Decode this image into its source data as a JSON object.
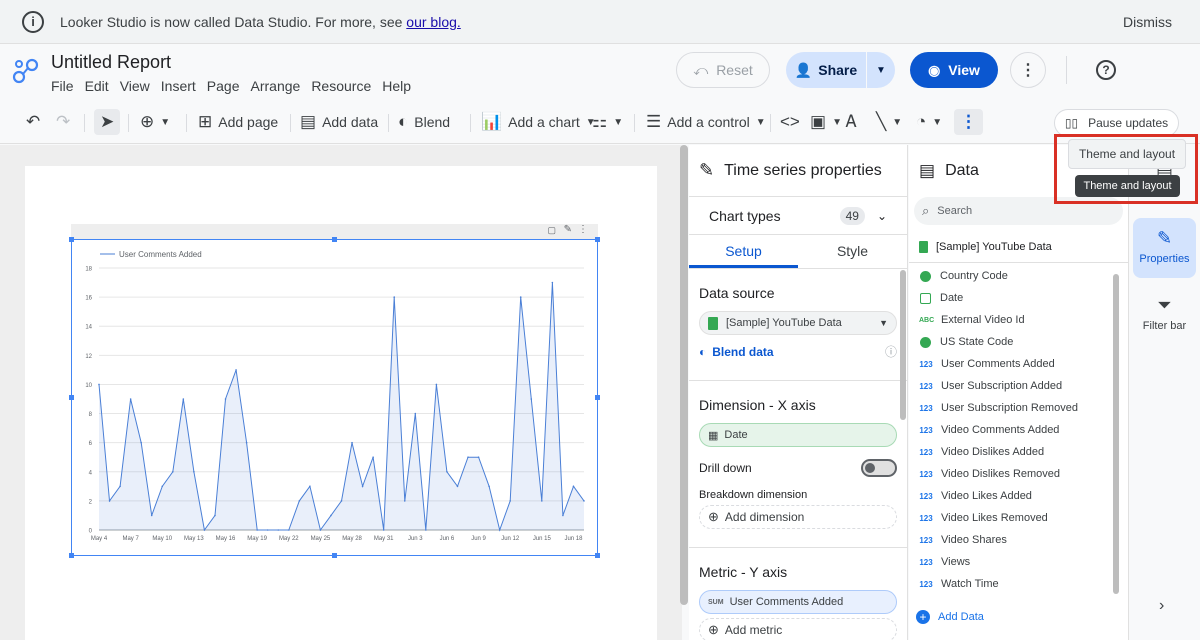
{
  "banner": {
    "message": "Looker Studio is now called Data Studio. For more, see ",
    "link": "our blog.",
    "dismiss": "Dismiss"
  },
  "header": {
    "title": "Untitled Report",
    "menu": [
      "File",
      "Edit",
      "View",
      "Insert",
      "Page",
      "Arrange",
      "Resource",
      "Help"
    ],
    "reset": "Reset",
    "share": "Share",
    "view": "View"
  },
  "toolbar": {
    "add_page": "Add page",
    "add_data": "Add data",
    "blend": "Blend",
    "add_chart": "Add a chart",
    "add_control": "Add a control",
    "pause": "Pause updates"
  },
  "chart_data": {
    "type": "line",
    "legend": "User Comments Added",
    "ylim": [
      0,
      18
    ],
    "yticks": [
      "0",
      "2",
      "4",
      "6",
      "8",
      "10",
      "12",
      "14",
      "16",
      "18"
    ],
    "xticks": [
      "May 4",
      "May 7",
      "May 10",
      "May 13",
      "May 16",
      "May 19",
      "May 22",
      "May 25",
      "May 28",
      "May 31",
      "Jun 3",
      "Jun 6",
      "Jun 9",
      "Jun 12",
      "Jun 15",
      "Jun 18"
    ],
    "values": [
      10,
      2,
      3,
      9,
      6,
      1,
      3,
      4,
      9,
      4,
      0,
      1,
      9,
      11,
      6,
      0,
      0,
      0,
      0,
      2,
      3,
      0,
      1,
      2,
      6,
      3,
      5,
      0,
      16,
      2,
      8,
      0,
      10,
      4,
      3,
      5,
      5,
      3,
      0,
      2,
      16,
      9,
      2,
      17,
      1,
      3,
      2
    ]
  },
  "properties": {
    "title": "Time series properties",
    "chart_types": "Chart types",
    "chart_types_count": "49",
    "tab_setup": "Setup",
    "tab_style": "Style",
    "data_source_title": "Data source",
    "data_source": "[Sample] YouTube Data",
    "blend_data": "Blend data",
    "dimension_title": "Dimension - X axis",
    "dimension": "Date",
    "drill_down": "Drill down",
    "breakdown": "Breakdown dimension",
    "add_dimension": "Add dimension",
    "metric_title": "Metric - Y axis",
    "metric_agg": "SUM",
    "metric": "User Comments Added",
    "add_metric": "Add metric"
  },
  "data_panel": {
    "title": "Data",
    "search": "Search",
    "source": "[Sample] YouTube Data",
    "fields": [
      {
        "icon": "geo",
        "name": "Country Code"
      },
      {
        "icon": "date",
        "name": "Date"
      },
      {
        "icon": "text",
        "name": "External Video Id"
      },
      {
        "icon": "geo",
        "name": "US State Code"
      },
      {
        "icon": "num",
        "name": "User Comments Added"
      },
      {
        "icon": "num",
        "name": "User Subscription Added"
      },
      {
        "icon": "num",
        "name": "User Subscription Removed"
      },
      {
        "icon": "num",
        "name": "Video Comments Added"
      },
      {
        "icon": "num",
        "name": "Video Dislikes Added"
      },
      {
        "icon": "num",
        "name": "Video Dislikes Removed"
      },
      {
        "icon": "num",
        "name": "Video Likes Added"
      },
      {
        "icon": "num",
        "name": "Video Likes Removed"
      },
      {
        "icon": "num",
        "name": "Video Shares"
      },
      {
        "icon": "num",
        "name": "Views"
      },
      {
        "icon": "num",
        "name": "Watch Time"
      }
    ],
    "icon_labels": {
      "text": "ABC",
      "num": "123"
    },
    "add_data": "Add Data"
  },
  "rail": {
    "data": "Data",
    "properties": "Properties",
    "filter": "Filter bar"
  },
  "tooltips": {
    "light": "Theme and layout",
    "dark": "Theme and layout"
  },
  "colors": {
    "accent": "#0b57d0",
    "line": "#4a7fd6",
    "highlight": "#d93025"
  }
}
